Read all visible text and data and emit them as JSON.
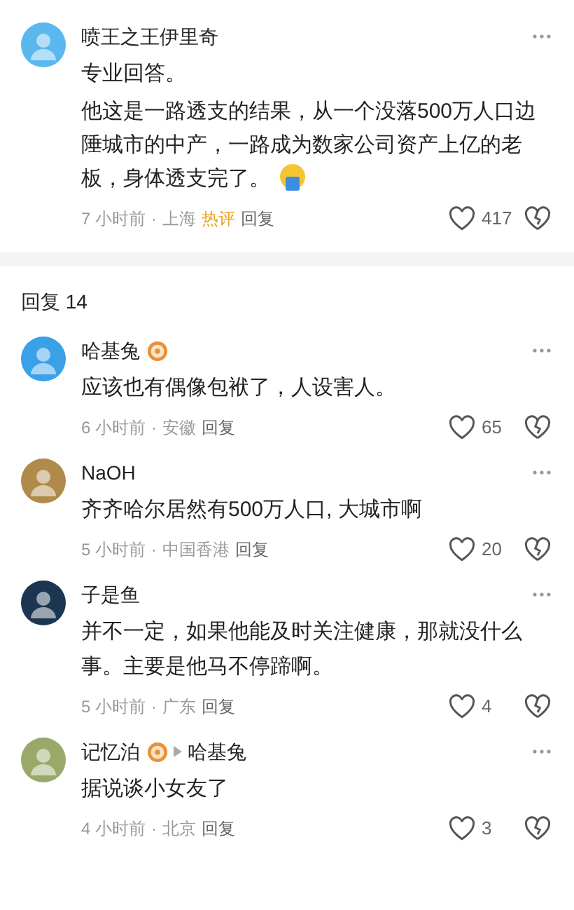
{
  "main_comment": {
    "author": "喷王之王伊里奇",
    "color": "#5bb8ee",
    "paragraphs": [
      "专业回答。",
      "他这是一路透支的结果，从一个没落500万人口边陲城市的中产，一路成为数家公司资产上亿的老板，身体透支完了。"
    ],
    "emoji": true,
    "time": "7 小时前",
    "separator": "·",
    "location": "上海",
    "tag": "热评",
    "reply": "回复",
    "likes": "417"
  },
  "replies_header": "回复 14",
  "replies": [
    {
      "author": "哈基兔",
      "color": "#3aa0e8",
      "badge": true,
      "text": "应该也有偶像包袱了，人设害人。",
      "time": "6 小时前",
      "separator": "·",
      "location": "安徽",
      "reply": "回复",
      "likes": "65"
    },
    {
      "author": "NaOH",
      "color": "#b08a4a",
      "badge": false,
      "text": "齐齐哈尔居然有500万人口, 大城市啊",
      "time": "5 小时前",
      "separator": "·",
      "location": "中国香港",
      "reply": "回复",
      "likes": "20"
    },
    {
      "author": "子是鱼",
      "color": "#1c3550",
      "badge": false,
      "text": "并不一定，如果他能及时关注健康，那就没什么事。主要是他马不停蹄啊。",
      "time": "5 小时前",
      "separator": "·",
      "location": "广东",
      "reply": "回复",
      "likes": "4"
    },
    {
      "author": "记忆泊",
      "color": "#9aa86a",
      "badge": true,
      "reply_to": "哈基兔",
      "text": "据说谈小女友了",
      "time": "4 小时前",
      "separator": "·",
      "location": "北京",
      "reply": "回复",
      "likes": "3"
    }
  ]
}
